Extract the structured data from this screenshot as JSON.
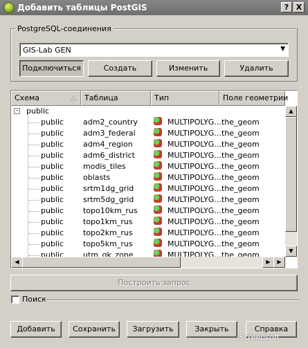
{
  "window": {
    "title": "Добавить таблицы PostGIS",
    "help_button": "?",
    "close_button": "X"
  },
  "connections": {
    "group_label": "PostgreSQL-соединения",
    "selected": "GIS-Lab GEN",
    "buttons": {
      "connect": "Подключиться",
      "create": "Создать",
      "edit": "Изменить",
      "delete": "Удалить"
    }
  },
  "table": {
    "columns": [
      "Схема",
      "Таблица",
      "Тип",
      "Поле геометрии"
    ],
    "schema_node": "public",
    "rows": [
      {
        "schema": "public",
        "table": "adm2_country",
        "type": "MULTIPOLYG...",
        "geom": "the_geom"
      },
      {
        "schema": "public",
        "table": "adm3_federal",
        "type": "MULTIPOLYG...",
        "geom": "the_geom"
      },
      {
        "schema": "public",
        "table": "adm4_region",
        "type": "MULTIPOLYG...",
        "geom": "the_geom"
      },
      {
        "schema": "public",
        "table": "adm6_district",
        "type": "MULTIPOLYG...",
        "geom": "the_geom"
      },
      {
        "schema": "public",
        "table": "modis_tiles",
        "type": "MULTIPOLYG...",
        "geom": "the_geom"
      },
      {
        "schema": "public",
        "table": "oblasts",
        "type": "MULTIPOLYG...",
        "geom": "the_geom"
      },
      {
        "schema": "public",
        "table": "srtm1dg_grid",
        "type": "MULTIPOLYG...",
        "geom": "the_geom"
      },
      {
        "schema": "public",
        "table": "srtm5dg_grid",
        "type": "MULTIPOLYG...",
        "geom": "the_geom"
      },
      {
        "schema": "public",
        "table": "topo10km_rus",
        "type": "MULTIPOLYG...",
        "geom": "the_geom"
      },
      {
        "schema": "public",
        "table": "topo1km_rus",
        "type": "MULTIPOLYG...",
        "geom": "the_geom"
      },
      {
        "schema": "public",
        "table": "topo2km_rus",
        "type": "MULTIPOLYG...",
        "geom": "the_geom"
      },
      {
        "schema": "public",
        "table": "topo5km_rus",
        "type": "MULTIPOLYG...",
        "geom": "the_geom"
      },
      {
        "schema": "public",
        "table": "utm_gk_zone",
        "type": "MULTIPOLYG...",
        "geom": "the_geom"
      }
    ]
  },
  "build_query_label": "Построить запрос",
  "search_label": "Поиск",
  "footer_buttons": {
    "add": "Добавить",
    "save": "Сохранить",
    "load": "Загрузить",
    "close": "Закрыть",
    "help": "Справка"
  },
  "watermark": "iScreensoft"
}
